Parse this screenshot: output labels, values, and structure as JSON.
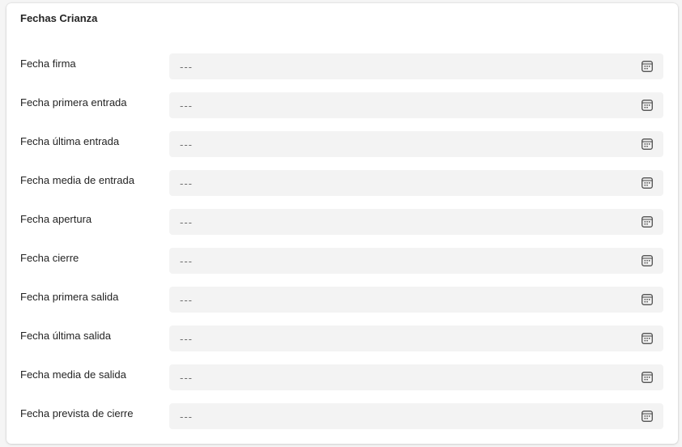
{
  "section": {
    "title": "Fechas Crianza"
  },
  "fields": [
    {
      "label": "Fecha firma",
      "value": "---",
      "icon": "calendar-icon"
    },
    {
      "label": "Fecha primera entrada",
      "value": "---",
      "icon": "calendar-icon"
    },
    {
      "label": "Fecha última entrada",
      "value": "---",
      "icon": "calendar-icon"
    },
    {
      "label": "Fecha media de entrada",
      "value": "---",
      "icon": "calendar-icon"
    },
    {
      "label": "Fecha apertura",
      "value": "---",
      "icon": "calendar-icon"
    },
    {
      "label": "Fecha cierre",
      "value": "---",
      "icon": "calendar-icon"
    },
    {
      "label": "Fecha primera salida",
      "value": "---",
      "icon": "calendar-icon"
    },
    {
      "label": "Fecha última salida",
      "value": "---",
      "icon": "calendar-icon"
    },
    {
      "label": "Fecha media de salida",
      "value": "---",
      "icon": "calendar-icon"
    },
    {
      "label": "Fecha prevista de cierre",
      "value": "---",
      "icon": "calendar-icon"
    }
  ]
}
